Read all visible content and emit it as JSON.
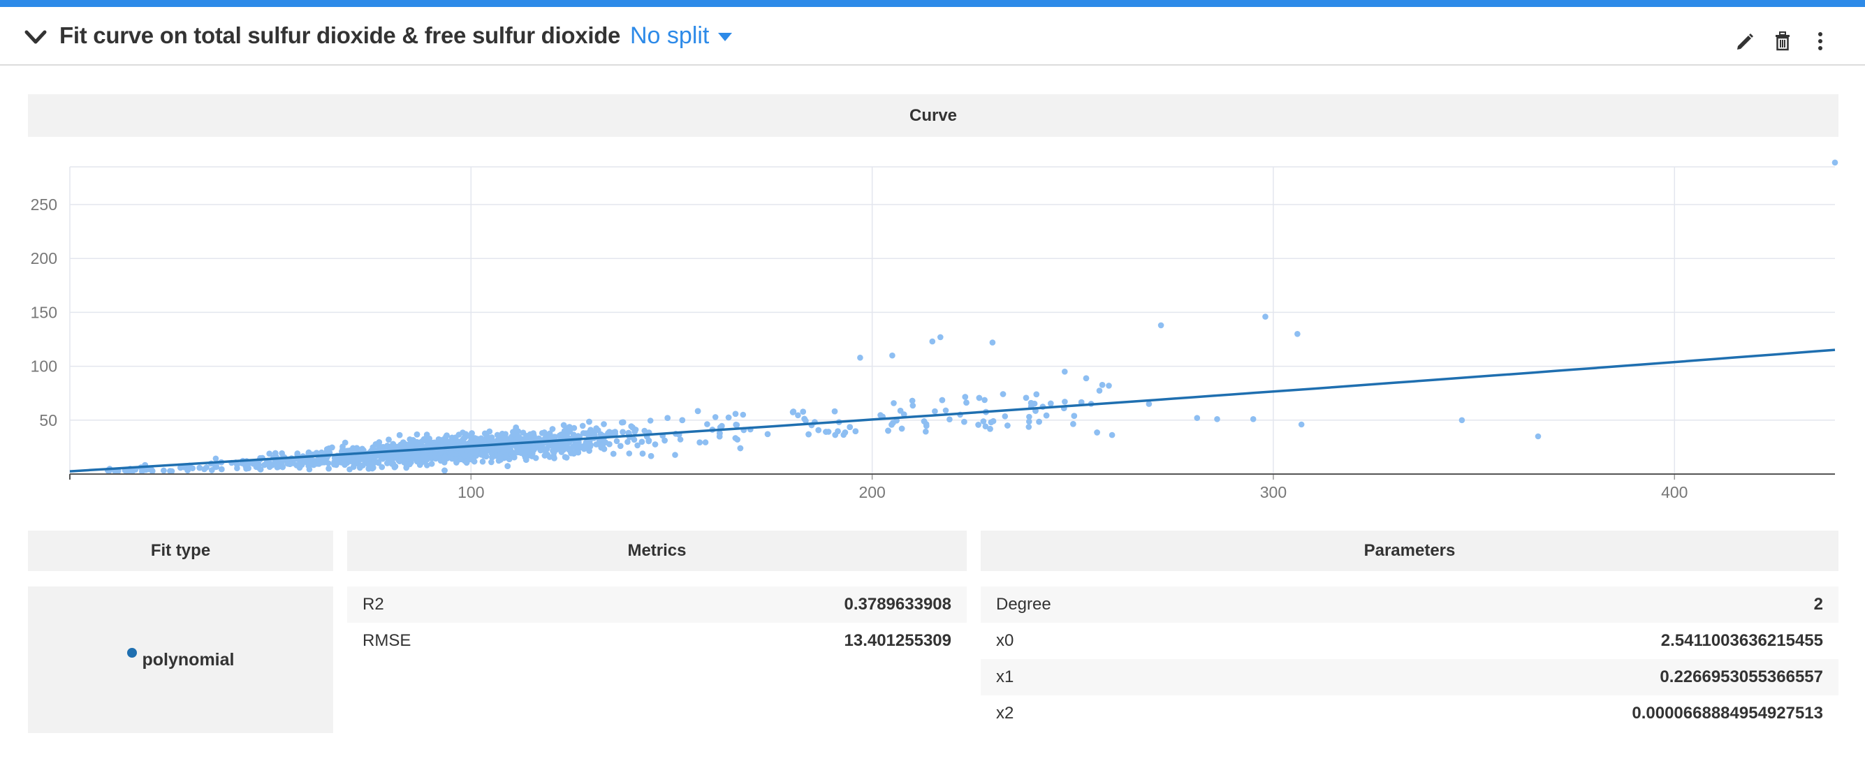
{
  "header": {
    "title": "Fit curve on total sulfur dioxide & free sulfur dioxide",
    "split_label": "No split",
    "accent_color": "#2d8ae8",
    "icons": [
      "chevron-down-icon",
      "pencil-icon",
      "trash-icon",
      "kebab-menu-icon"
    ]
  },
  "curve_section": {
    "title": "Curve"
  },
  "chart_data": {
    "type": "scatter",
    "title": "",
    "xlabel": "",
    "ylabel": "",
    "xlim": [
      0,
      440
    ],
    "ylim": [
      0,
      285
    ],
    "x_ticks": [
      100,
      200,
      300,
      400
    ],
    "y_ticks": [
      50,
      100,
      150,
      200,
      250
    ],
    "grid": true,
    "point_color": "#8dbef2",
    "fit_color": "#1f6fb0",
    "cluster": {
      "description_x_range": [
        9,
        260
      ],
      "relationship": "free sulfur dioxide increases with total sulfur dioxide",
      "approx_point_count": 2400
    },
    "outliers": [
      {
        "x": 440,
        "y": 289
      },
      {
        "x": 272,
        "y": 138
      },
      {
        "x": 298,
        "y": 146
      },
      {
        "x": 306,
        "y": 130
      },
      {
        "x": 281,
        "y": 52
      },
      {
        "x": 286,
        "y": 51
      },
      {
        "x": 295,
        "y": 51
      },
      {
        "x": 307,
        "y": 46
      },
      {
        "x": 269,
        "y": 65
      },
      {
        "x": 347,
        "y": 50
      },
      {
        "x": 366,
        "y": 35
      },
      {
        "x": 248,
        "y": 95
      },
      {
        "x": 259,
        "y": 82
      },
      {
        "x": 217,
        "y": 127
      },
      {
        "x": 215,
        "y": 123
      },
      {
        "x": 205,
        "y": 110
      },
      {
        "x": 230,
        "y": 122
      },
      {
        "x": 197,
        "y": 108
      }
    ],
    "fit": {
      "type": "polynomial",
      "degree": 2,
      "coefficients": [
        2.5411003636215455,
        0.2266953055366557,
        6.68884954927513e-05
      ]
    }
  },
  "fit_type": {
    "header": "Fit type",
    "value": "polynomial"
  },
  "metrics": {
    "header": "Metrics",
    "rows": [
      {
        "name": "R2",
        "value": "0.3789633908"
      },
      {
        "name": "RMSE",
        "value": "13.401255309"
      }
    ]
  },
  "parameters": {
    "header": "Parameters",
    "rows": [
      {
        "name": "Degree",
        "value": "2"
      },
      {
        "name": "x0",
        "value": "2.5411003636215455"
      },
      {
        "name": "x1",
        "value": "0.2266953055366557"
      },
      {
        "name": "x2",
        "value": "0.0000668884954927513"
      }
    ]
  }
}
